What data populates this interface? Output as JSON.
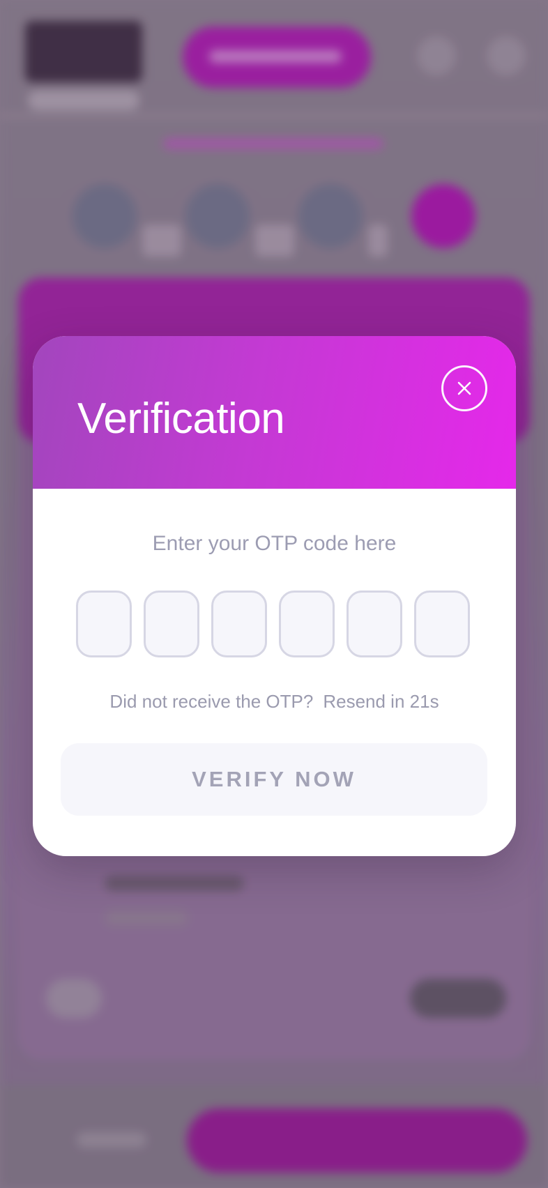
{
  "modal": {
    "title": "Verification",
    "close_icon": "close-icon",
    "otp_label": "Enter your OTP code here",
    "otp_digits": [
      "",
      "",
      "",
      "",
      "",
      ""
    ],
    "resend_prompt": "Did not receive the OTP?",
    "resend_timer": "Resend in 21s",
    "verify_label": "VERIFY NOW"
  },
  "colors": {
    "header_gradient_start": "#a246bd",
    "header_gradient_end": "#e528ea",
    "otp_box_border": "#d6d6e4",
    "otp_box_fill": "#f6f6fb",
    "muted_text": "#9c9cb2",
    "verify_button_bg": "#f6f6fb"
  }
}
